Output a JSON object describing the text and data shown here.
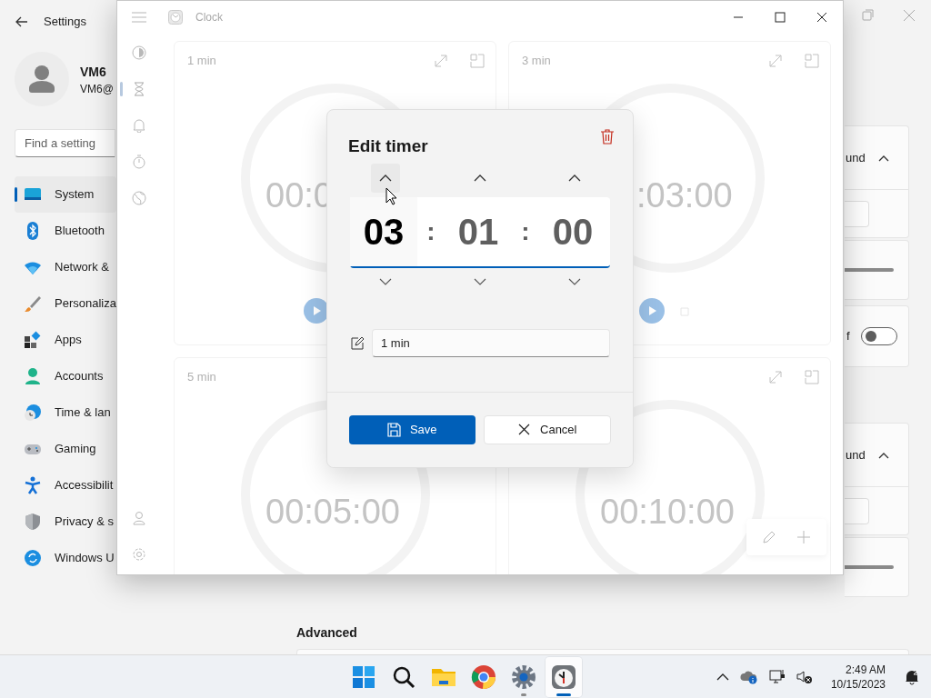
{
  "settings_window": {
    "title": "Settings",
    "user": {
      "name": "VM6",
      "email": "VM6@"
    },
    "search": {
      "placeholder": "Find a setting"
    },
    "nav_items": [
      {
        "kind": "system",
        "label": "System",
        "selected": true
      },
      {
        "kind": "bluetooth",
        "label": "Bluetooth",
        "selected": false
      },
      {
        "kind": "network",
        "label": "Network &",
        "selected": false
      },
      {
        "kind": "personalization",
        "label": "Personaliza",
        "selected": false
      },
      {
        "kind": "apps",
        "label": "Apps",
        "selected": false
      },
      {
        "kind": "accounts",
        "label": "Accounts",
        "selected": false
      },
      {
        "kind": "time",
        "label": "Time & lan",
        "selected": false
      },
      {
        "kind": "gaming",
        "label": "Gaming",
        "selected": false
      },
      {
        "kind": "accessibility",
        "label": "Accessibilit",
        "selected": false
      },
      {
        "kind": "privacy",
        "label": "Privacy & s",
        "selected": false
      },
      {
        "kind": "update",
        "label": "Windows U",
        "selected": false
      }
    ],
    "groups": [
      {
        "header": "und",
        "row_label": "f",
        "toggle": {
          "on": false
        }
      },
      {
        "header": "und"
      }
    ],
    "section_heading": "Advanced"
  },
  "clock_window": {
    "title": "Clock",
    "nav": [
      {
        "kind": "focus",
        "selected": false
      },
      {
        "kind": "timer",
        "selected": true
      },
      {
        "kind": "alarm",
        "selected": false
      },
      {
        "kind": "stopwatch",
        "selected": false
      },
      {
        "kind": "world",
        "selected": false
      }
    ],
    "timers": [
      {
        "title": "1 min",
        "time": "00:0",
        "controls": true
      },
      {
        "title": "3 min",
        "time": ":03:00",
        "controls": true
      },
      {
        "title": "5 min",
        "time": "00:05:00"
      },
      {
        "time": "00:10:00"
      }
    ]
  },
  "dialog": {
    "title": "Edit timer",
    "segments": [
      {
        "value": "03",
        "selected": true
      },
      {
        "value": "01",
        "selected": false
      },
      {
        "value": "00",
        "selected": false
      }
    ],
    "separators": [
      ":",
      ":"
    ],
    "name_field": {
      "value": "1 min"
    },
    "buttons": [
      {
        "kind": "primary",
        "label": "Save"
      },
      {
        "kind": "secondary",
        "label": "Cancel"
      }
    ]
  },
  "taskbar": {
    "apps": [
      {
        "kind": "start",
        "running": false,
        "selected": false
      },
      {
        "kind": "search",
        "running": false,
        "selected": false
      },
      {
        "kind": "files",
        "running": false,
        "selected": false
      },
      {
        "kind": "browser",
        "running": false,
        "selected": false
      },
      {
        "kind": "settings",
        "running": true,
        "selected": false
      },
      {
        "kind": "clock",
        "running": true,
        "selected": true
      }
    ],
    "time": "2:49 AM",
    "date": "10/15/2023"
  }
}
